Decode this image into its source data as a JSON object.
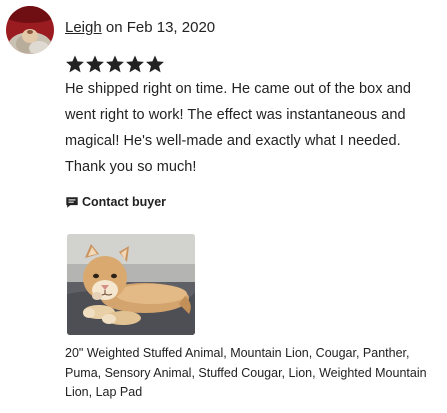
{
  "review": {
    "reviewer_name": "Leigh",
    "date_text": "on Feb 13, 2020",
    "rating": 5,
    "max_rating": 5,
    "text": "He shipped right on time. He came out of the box and went right to work! The effect was instantaneous and magical! He's well-made and exactly what I needed. Thank you so much!",
    "contact_label": "Contact buyer"
  },
  "product": {
    "title": "20\" Weighted Stuffed Animal, Mountain Lion, Cougar, Panther, Puma, Sensory Animal, Stuffed Cougar, Lion, Weighted Mountain Lion, Lap Pad"
  },
  "colors": {
    "star": "#222222",
    "avatar_background": "#9b1c20",
    "text": "#222222"
  },
  "icons": {
    "contact": "message-icon",
    "star": "star-icon"
  }
}
